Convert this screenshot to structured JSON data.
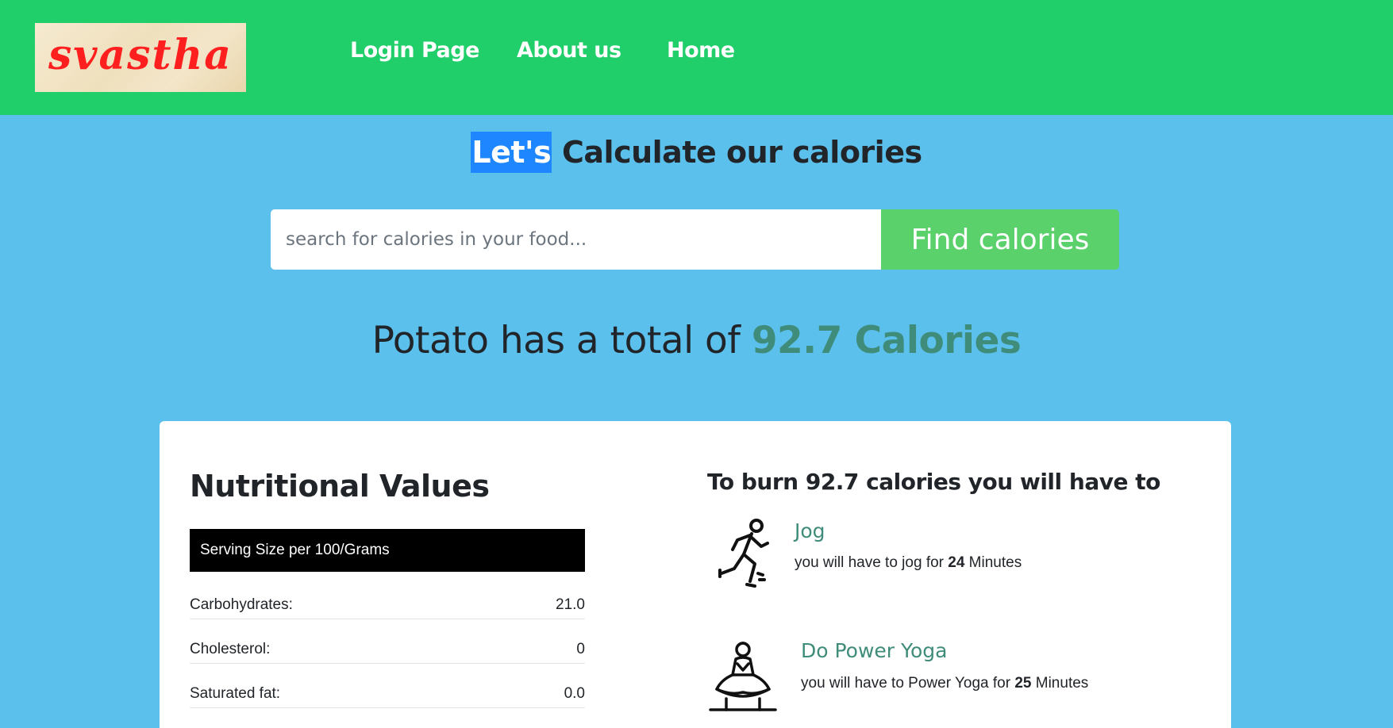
{
  "header": {
    "logo_text": "svastha",
    "nav": [
      {
        "label": "Login Page"
      },
      {
        "label": "About us"
      },
      {
        "label": "Home"
      }
    ]
  },
  "title": {
    "highlight": "Let's",
    "rest": " Calculate our calories"
  },
  "search": {
    "placeholder": "search for calories in your food...",
    "value": "",
    "button_label": "Find calories"
  },
  "result": {
    "food": "Potato",
    "middle": " has a total of ",
    "calories": "92.7 Calories"
  },
  "nutrition": {
    "title": "Nutritional Values",
    "serving": "Serving Size per 100/Grams",
    "rows": [
      {
        "label": "Carbohydrates:",
        "value": "21.0"
      },
      {
        "label": "Cholesterol:",
        "value": "0"
      },
      {
        "label": "Saturated fat:",
        "value": "0.0"
      }
    ]
  },
  "burn": {
    "title": "To burn 92.7 calories you will have to",
    "activities": [
      {
        "name": "Jog",
        "desc_prefix": "you will have to jog for ",
        "minutes": "24",
        "desc_suffix": " Minutes",
        "icon": "running-person-icon"
      },
      {
        "name": "Do Power Yoga",
        "desc_prefix": "you will have to Power Yoga for ",
        "minutes": "25",
        "desc_suffix": " Minutes",
        "icon": "yoga-meditation-icon"
      }
    ]
  },
  "colors": {
    "navbar": "#20cf69",
    "background": "#5bc0eb",
    "button": "#5bd16b",
    "accent_text": "#3f8c7a",
    "highlight": "#1e86ff"
  }
}
